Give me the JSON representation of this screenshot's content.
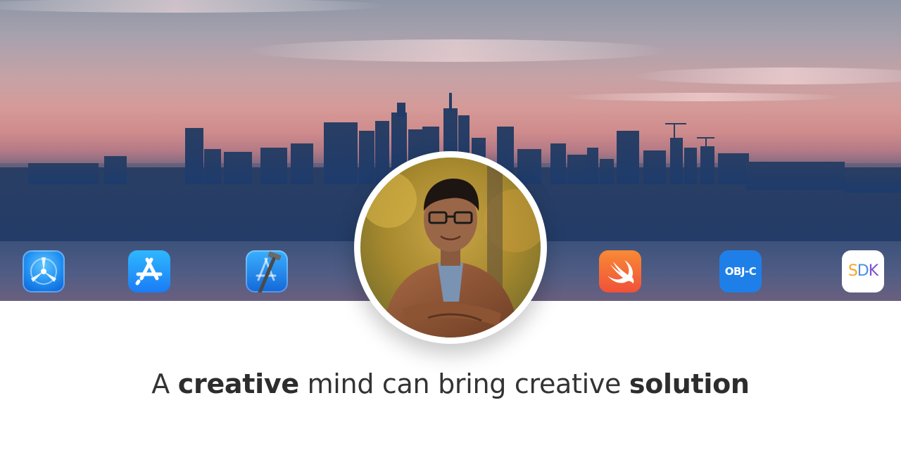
{
  "banner": {
    "background": "city-skyline-sunset",
    "colors": {
      "sky_top": "#8f96a6",
      "sky_glow": "#d59a98",
      "city": "#1f3d6e",
      "text": "#333333"
    }
  },
  "tech_icons": [
    {
      "name": "instruments-icon",
      "label": ""
    },
    {
      "name": "app-store-icon",
      "label": ""
    },
    {
      "name": "xcode-icon",
      "label": ""
    },
    {
      "name": "swift-icon",
      "label": ""
    },
    {
      "name": "objc-icon",
      "label": "OBJ-C"
    },
    {
      "name": "sdk-icon",
      "label_parts": [
        "S",
        "D",
        "K"
      ]
    }
  ],
  "profile": {
    "photo": "profile-photo",
    "description": "portrait-in-leather-jacket"
  },
  "tagline": {
    "part1": "A ",
    "bold1": "creative",
    "part2": " mind can bring creative ",
    "bold2": "solution"
  }
}
